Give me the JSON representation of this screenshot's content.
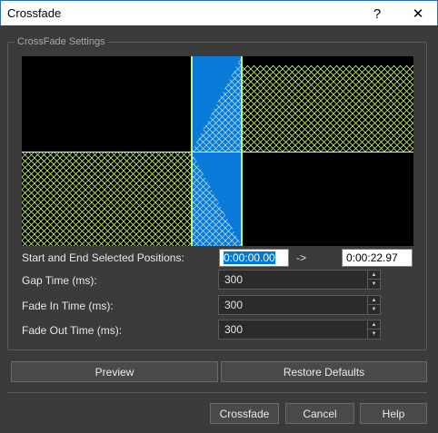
{
  "window": {
    "title": "Crossfade",
    "help_glyph": "?",
    "close_glyph": "✕"
  },
  "group": {
    "label": "CrossFade Settings"
  },
  "positions": {
    "label": "Start and End Selected Positions:",
    "start": "0:00:00.00",
    "arrow": "->",
    "end": "0:00:22.97"
  },
  "gap": {
    "label": "Gap Time (ms):",
    "value": "300"
  },
  "fade_in": {
    "label": "Fade In Time (ms):",
    "value": "300"
  },
  "fade_out": {
    "label": "Fade Out Time (ms):",
    "value": "300"
  },
  "actions": {
    "preview": "Preview",
    "restore": "Restore Defaults"
  },
  "footer": {
    "crossfade": "Crossfade",
    "cancel": "Cancel",
    "help": "Help"
  },
  "colors": {
    "hatch": "#c8f07a",
    "selection": "#0a7ad8",
    "marker": "#c8f07a"
  },
  "icons": {
    "spin_up": "spin-up-arrow-icon",
    "spin_down": "spin-down-arrow-icon"
  }
}
